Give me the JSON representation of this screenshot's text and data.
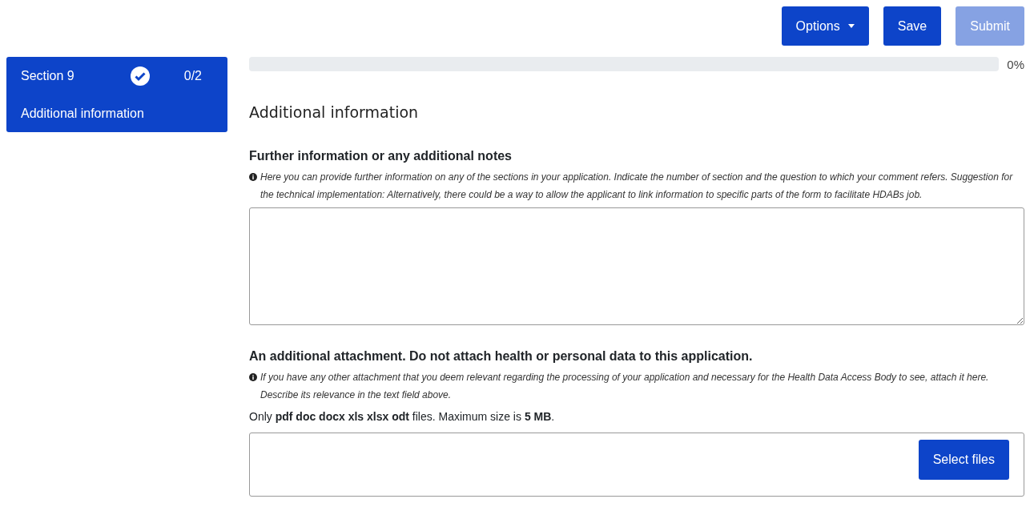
{
  "toolbar": {
    "buttons": [
      {
        "label": "Options",
        "kind": "dropdown",
        "disabled": false
      },
      {
        "label": "Save",
        "kind": "plain",
        "disabled": false
      },
      {
        "label": "Submit",
        "kind": "plain",
        "disabled": true
      }
    ]
  },
  "sidebar": {
    "items": [
      {
        "section": "Section 9",
        "completed": true,
        "count": "0/2",
        "title": "Additional information",
        "selected": true
      }
    ]
  },
  "progress": {
    "level": 0,
    "reading": "0%"
  },
  "form": {
    "heading": "Additional information",
    "fields": [
      {
        "kind": "textarea",
        "label": "Further information or any additional notes",
        "help": "Here you can provide further information on any of the sections in your application. Indicate the number of section and the question to which your comment refers. Suggestion for the technical implementation: Alternatively, there could be a way to allow the applicant to link information to specific parts of the form to facilitate HDABs job."
      },
      {
        "kind": "file",
        "label": "An additional attachment. Do not attach health or personal data to this application.",
        "help": "If you have any other attachment that you deem relevant regarding the processing of your application and necessary for the Health Data Access Body to see, attach it here. Describe its relevance in the text field above.",
        "note": "Only **pdf doc docx xls xlsx odt** files. Maximum size is **5 MB**.",
        "button": "Select files"
      }
    ]
  }
}
